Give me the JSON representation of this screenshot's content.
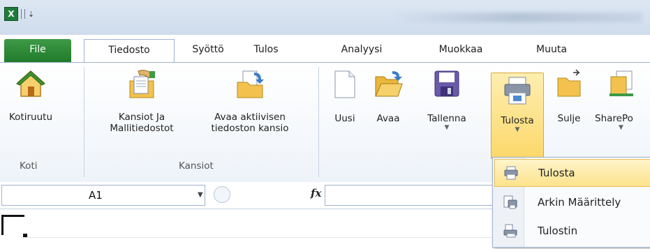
{
  "qat": {
    "logo": "X",
    "dropdown": "⇣"
  },
  "tabs": {
    "file": "File",
    "tiedosto": "Tiedosto",
    "syotto": "Syöttö",
    "tulos": "Tulos",
    "analyysi": "Analyysi",
    "muokkaa": "Muokkaa",
    "muuta": "Muuta"
  },
  "ribbon": {
    "koti": {
      "kotiruutu": "Kotiruutu",
      "group": "Koti"
    },
    "kansiot": {
      "mallit_line1": "Kansiot Ja",
      "mallit_line2": "Mallitiedostot",
      "avaa_line1": "Avaa aktiivisen",
      "avaa_line2": "tiedoston kansio",
      "group": "Kansiot"
    },
    "file_ops": {
      "uusi": "Uusi",
      "avaa": "Avaa",
      "tallenna": "Tallenna",
      "tulosta": "Tulosta",
      "sulje": "Sulje",
      "sharepoint": "SharePo"
    }
  },
  "formula_bar": {
    "name_box": "A1",
    "fx": "fx"
  },
  "print_menu": {
    "items": [
      "Tulosta",
      "Arkin Määrittely",
      "Tulostin"
    ]
  },
  "colors": {
    "file_tab": "#2a8a35",
    "highlight": "#fcd86b",
    "ribbon_border": "#9fb3cc"
  }
}
